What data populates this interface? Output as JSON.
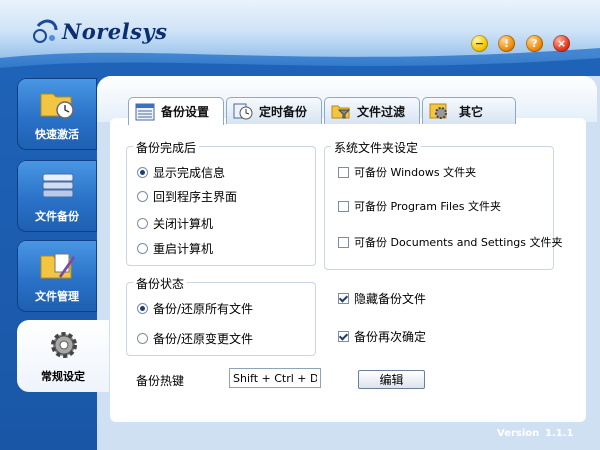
{
  "app": {
    "logo_text": "Norelsys"
  },
  "window_controls": {
    "minimize": "−",
    "warn": "!",
    "help": "?",
    "close": "×"
  },
  "sidebar": {
    "items": [
      {
        "label": "快速激活",
        "icon": "clock-folder-icon"
      },
      {
        "label": "文件备份",
        "icon": "stack-icon"
      },
      {
        "label": "文件管理",
        "icon": "folder-pen-icon"
      },
      {
        "label": "常规设定",
        "icon": "gear-icon"
      }
    ],
    "active": 3
  },
  "tabs": [
    {
      "label": "备份设置",
      "icon": "list-icon"
    },
    {
      "label": "定时备份",
      "icon": "clock-icon"
    },
    {
      "label": "文件过滤",
      "icon": "funnel-folder-icon"
    },
    {
      "label": "其它",
      "icon": "gear-icon"
    }
  ],
  "active_tab": 0,
  "backup_complete": {
    "title": "备份完成后",
    "options": [
      "显示完成信息",
      "回到程序主界面",
      "关闭计算机",
      "重启计算机"
    ],
    "selected": 0
  },
  "system_folders": {
    "title": "系统文件夹设定",
    "options": [
      {
        "label": "可备份 Windows 文件夹",
        "checked": false
      },
      {
        "label": "可备份 Program Files 文件夹",
        "checked": false
      },
      {
        "label": "可备份 Documents and Settings 文件夹",
        "checked": false
      }
    ]
  },
  "backup_status": {
    "title": "备份状态",
    "options": [
      "备份/还原所有文件",
      "备份/还原变更文件"
    ],
    "selected": 0
  },
  "extra_options": [
    {
      "label": "隐藏备份文件",
      "checked": true
    },
    {
      "label": "备份再次确定",
      "checked": true
    }
  ],
  "hotkey": {
    "label": "备份热键",
    "value": "Shift + Ctrl + D",
    "edit_label": "编辑"
  },
  "footer": {
    "version_label": "Version",
    "version": "1.1.1"
  },
  "colors": {
    "accent": "#1e63b8",
    "header": "#cfe3f7",
    "panel": "#ffffff"
  }
}
